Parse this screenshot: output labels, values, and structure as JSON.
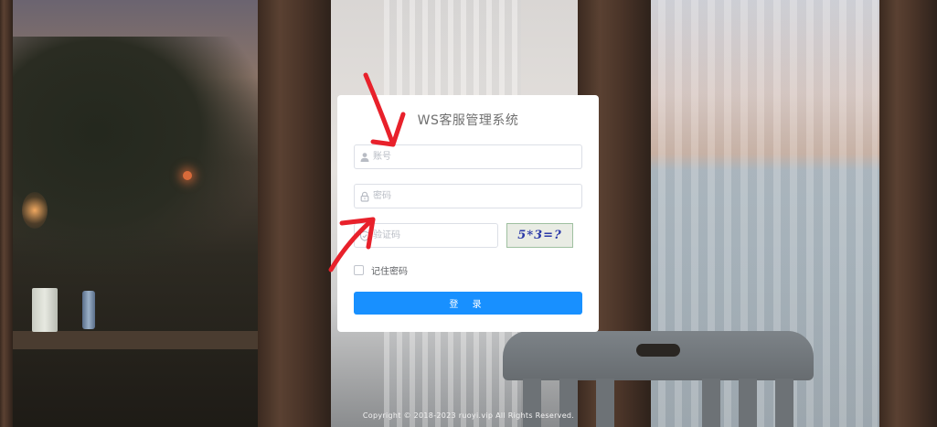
{
  "title": "WS客服管理系统",
  "form": {
    "username_placeholder": "账号",
    "password_placeholder": "密码",
    "code_placeholder": "验证码",
    "captcha_text": "5*3=?",
    "remember_label": "记住密码",
    "remember_checked": false,
    "login_button": "登 录"
  },
  "icons": {
    "username": "user-icon",
    "password": "lock-icon",
    "code": "shield-icon"
  },
  "colors": {
    "primary": "#1890ff",
    "annotation": "#e8212b"
  },
  "footer": "Copyright © 2018-2023 ruoyi.vip All Rights Reserved."
}
